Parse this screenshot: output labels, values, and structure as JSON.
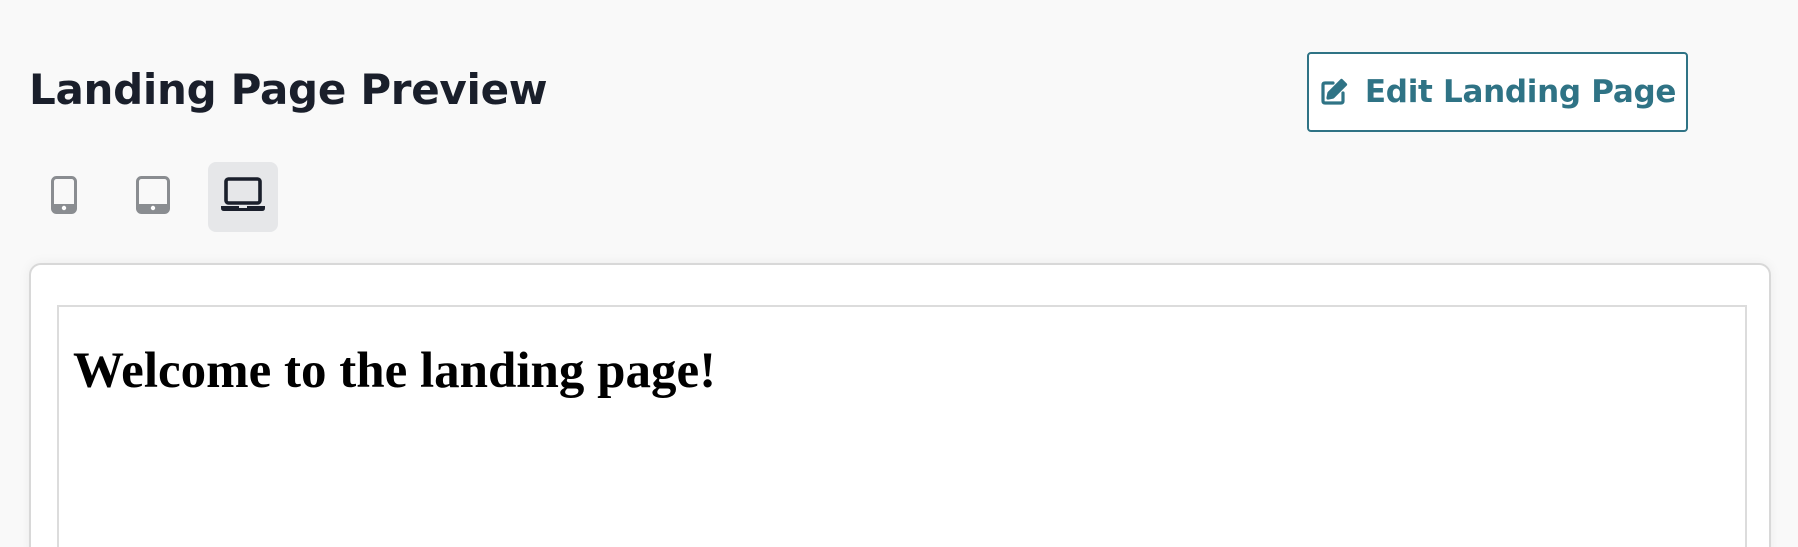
{
  "header": {
    "title": "Landing Page Preview",
    "edit_button_label": "Edit Landing Page",
    "edit_icon": "edit-icon",
    "accent_color": "#2f7385"
  },
  "device_switcher": {
    "options": [
      {
        "name": "mobile",
        "icon": "mobile-phone-icon",
        "selected": false
      },
      {
        "name": "tablet",
        "icon": "tablet-icon",
        "selected": false
      },
      {
        "name": "desktop",
        "icon": "laptop-icon",
        "selected": true
      }
    ]
  },
  "preview": {
    "heading": "Welcome to the landing page!"
  }
}
